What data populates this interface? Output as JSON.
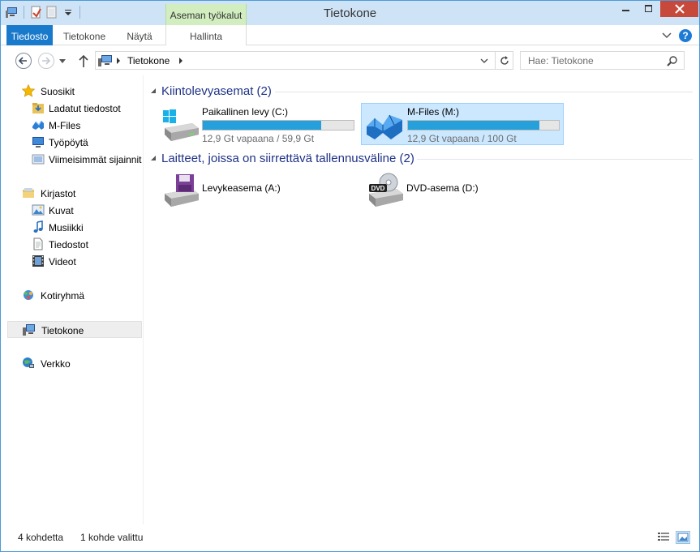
{
  "window": {
    "title": "Tietokone",
    "context_tab_header": "Aseman työkalut"
  },
  "ribbon": {
    "tabs": [
      "Tiedosto",
      "Tietokone",
      "Näytä",
      "Hallinta"
    ],
    "help_label": "?"
  },
  "navigation": {
    "address": "Tietokone",
    "search_placeholder": "Hae: Tietokone"
  },
  "sidebar": {
    "favorites": {
      "label": "Suosikit",
      "items": [
        "Ladatut tiedostot",
        "M-Files",
        "Työpöytä",
        "Viimeisimmät sijainnit"
      ]
    },
    "libraries": {
      "label": "Kirjastot",
      "items": [
        "Kuvat",
        "Musiikki",
        "Tiedostot",
        "Videot"
      ]
    },
    "homegroup": "Kotiryhmä",
    "computer": "Tietokone",
    "network": "Verkko"
  },
  "main": {
    "hard_drives_header": "Kiintolevyasemat (2)",
    "drives": [
      {
        "name": "Paikallinen levy (C:)",
        "free_text": "12,9 Gt vapaana / 59,9 Gt",
        "used_fraction": 0.785,
        "selected": false
      },
      {
        "name": "M-Files (M:)",
        "free_text": "12,9 Gt vapaana / 100 Gt",
        "used_fraction": 0.871,
        "selected": true
      }
    ],
    "removable_header": "Laitteet, joissa on siirrettävä tallennusväline (2)",
    "devices": [
      {
        "name": "Levykeasema (A:)"
      },
      {
        "name": "DVD-asema (D:)",
        "badge": "DVD"
      }
    ]
  },
  "status": {
    "item_count": "4 kohdetta",
    "selected_count": "1 kohde valittu"
  },
  "colors": {
    "accent": "#1979ca",
    "drive_bar": "#26a0da",
    "context_tab": "#d2eec0",
    "close_button": "#c7493b",
    "group_header": "#1e3287",
    "selection": "#cce8ff"
  }
}
